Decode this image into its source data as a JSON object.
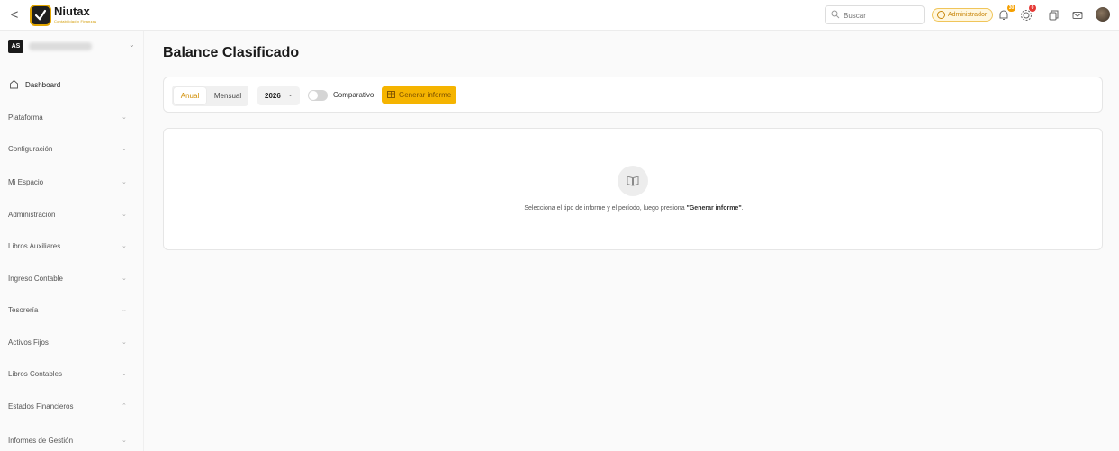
{
  "header": {
    "back_label": "<",
    "brand_name": "Niutax",
    "brand_tagline": "Contabilidad y Finanzas",
    "search_placeholder": "Buscar",
    "role_label": "Administrador",
    "notifications_count": "30",
    "alerts_count": "0"
  },
  "sidebar": {
    "company_badge": "AS",
    "items": [
      {
        "label": "Dashboard"
      },
      {
        "label": "Plataforma"
      },
      {
        "label": "Configuración"
      },
      {
        "label": "Mi Espacio"
      },
      {
        "label": "Administración"
      },
      {
        "label": "Libros Auxiliares"
      },
      {
        "label": "Ingreso Contable"
      },
      {
        "label": "Tesorería"
      },
      {
        "label": "Activos Fijos"
      },
      {
        "label": "Libros Contables"
      },
      {
        "label": "Estados Financieros"
      },
      {
        "label": "Informes de Gestión"
      }
    ],
    "chevron_down": "⌄",
    "chevron_up": "⌃"
  },
  "main": {
    "title": "Balance Clasificado",
    "filters": {
      "anual": "Anual",
      "mensual": "Mensual",
      "year": "2026",
      "comparativo": "Comparativo",
      "generate": "Generar informe"
    },
    "empty": {
      "msg_prefix": "Selecciona el tipo de informe y el período, luego presiona ",
      "msg_bold": "\"Generar informe\"",
      "msg_suffix": "."
    }
  },
  "colors": {
    "accent": "#f5b400",
    "accent_text": "#d08c00",
    "badge_orange": "#f5a000",
    "badge_red": "#e53935"
  }
}
